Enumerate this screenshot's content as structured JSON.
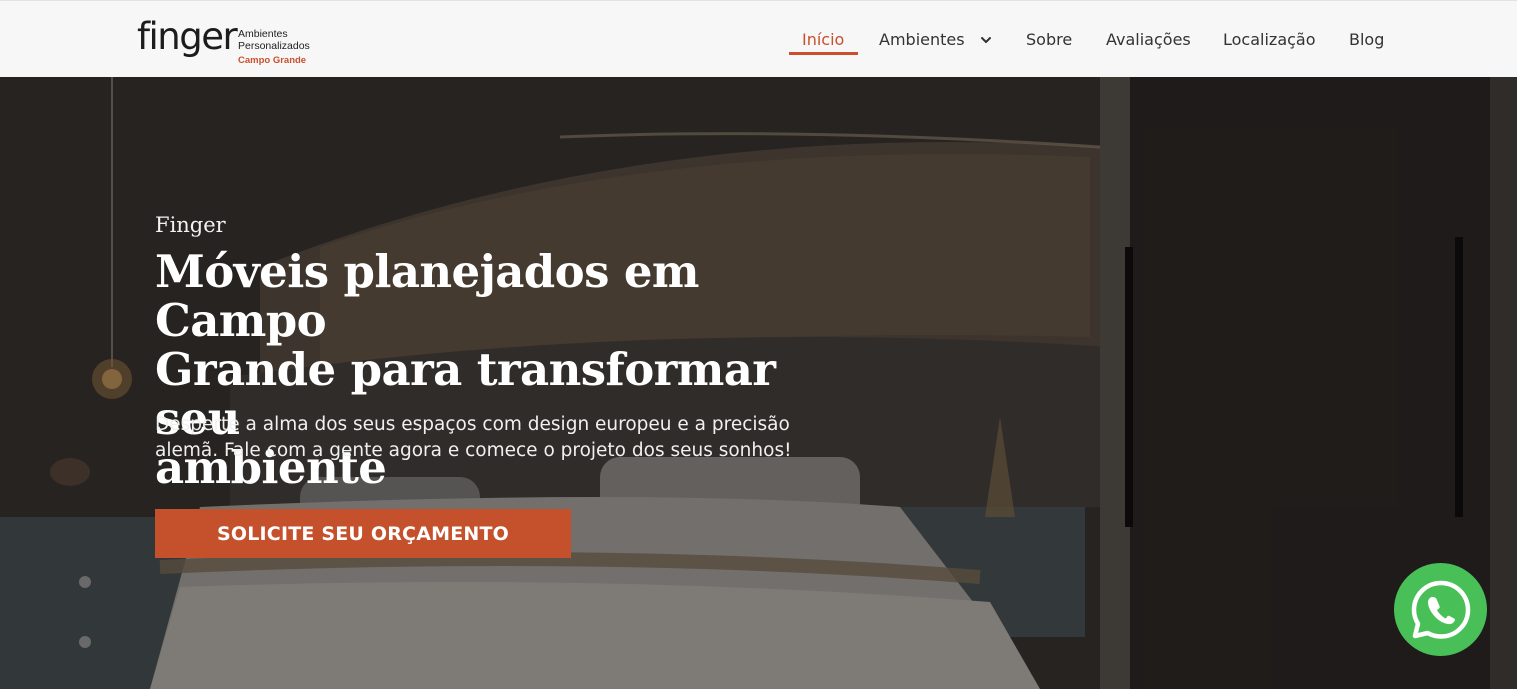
{
  "logo": {
    "word": "finger",
    "line1": "Ambientes",
    "line2": "Personalizados",
    "city": "Campo Grande"
  },
  "nav": {
    "items": [
      {
        "label": "Início",
        "active": true
      },
      {
        "label": "Ambientes",
        "active": false,
        "has_dropdown": true
      },
      {
        "label": "Sobre",
        "active": false
      },
      {
        "label": "Avaliações",
        "active": false
      },
      {
        "label": "Localização",
        "active": false
      },
      {
        "label": "Blog",
        "active": false
      }
    ]
  },
  "hero": {
    "eyebrow": "Finger",
    "headline_line1": "Móveis planejados em Campo",
    "headline_line2": "Grande para transformar seu",
    "headline_line3": "ambiente",
    "subtext_line1": "Desperte a alma dos seus espaços com design europeu e a precisão",
    "subtext_line2": "alemã. Fale com a gente agora e comece o projeto dos seus sonhos!",
    "cta_label": "SOLICITE SEU ORÇAMENTO"
  },
  "floating": {
    "whatsapp_icon": "whatsapp-icon"
  },
  "colors": {
    "accent": "#c8502e",
    "header_bg": "#f7f7f7",
    "whatsapp": "#48c057"
  }
}
